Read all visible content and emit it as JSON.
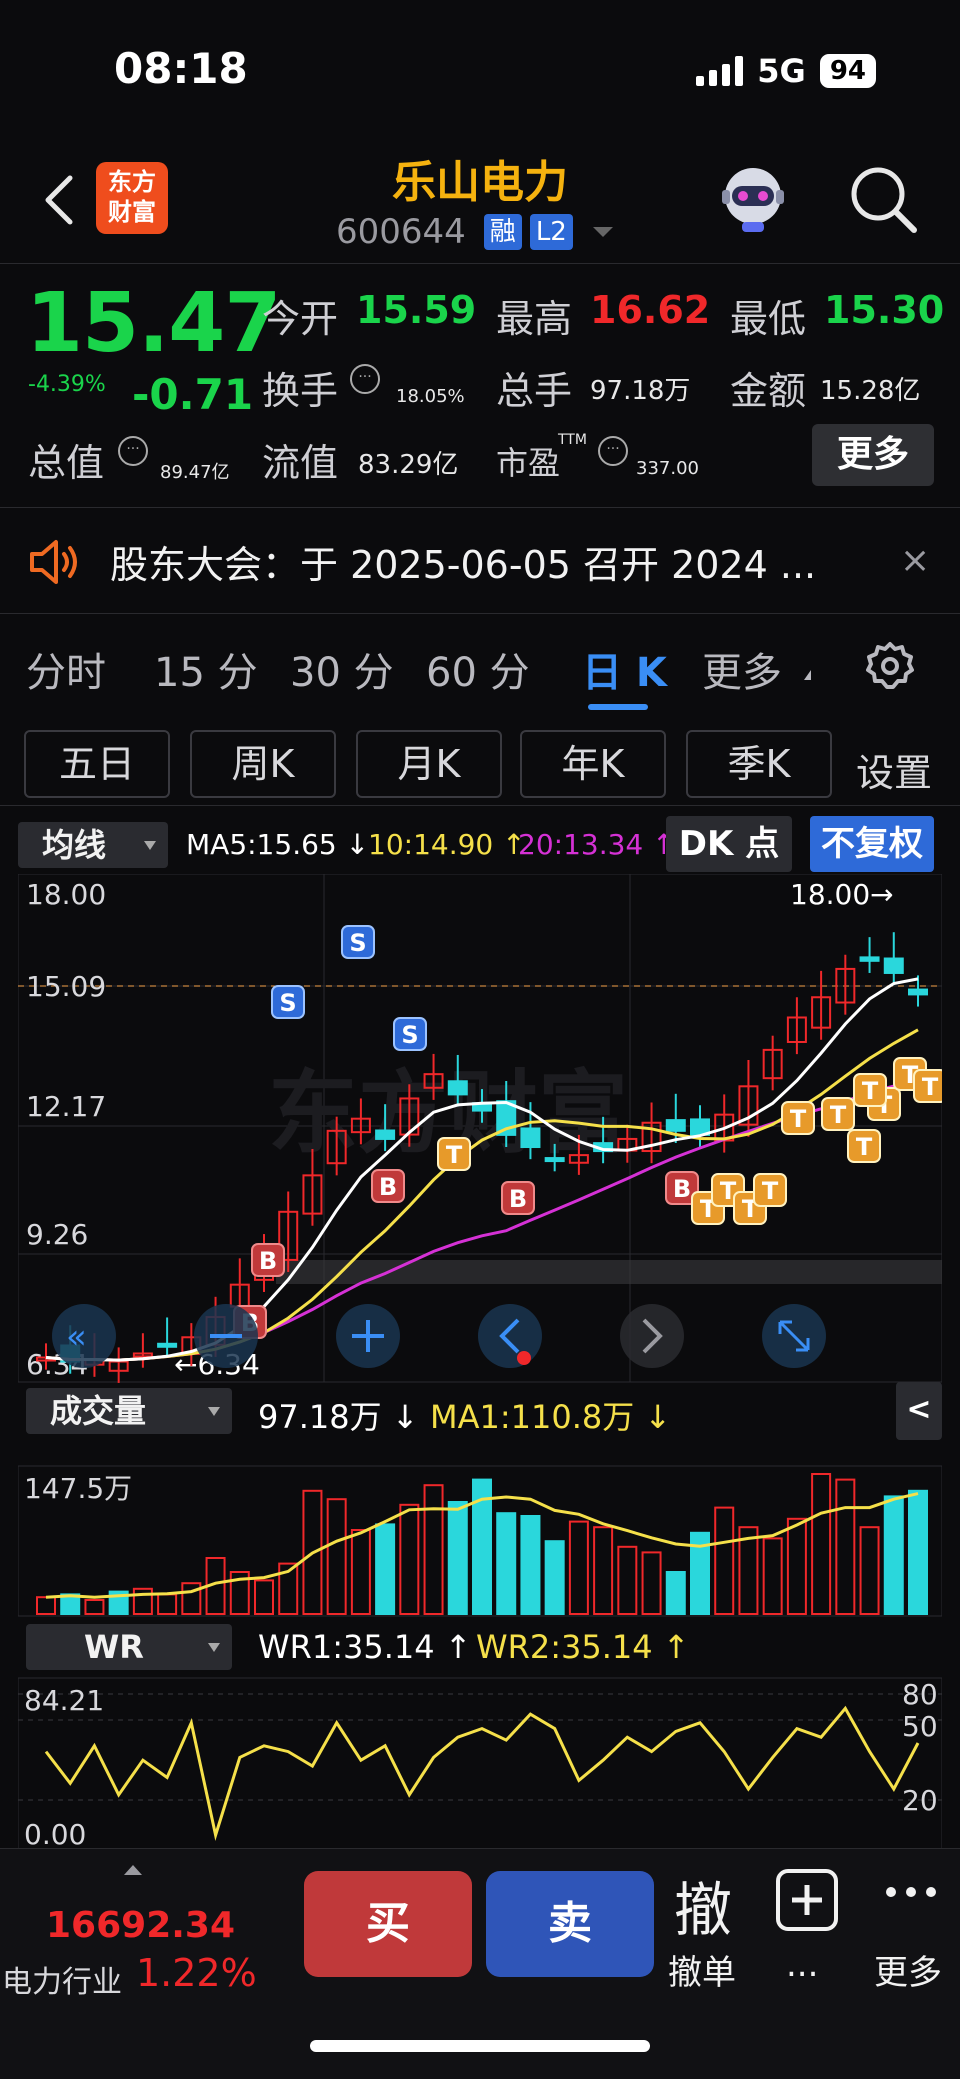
{
  "status_bar": {
    "time": "08:18",
    "network": "5G",
    "battery": "94"
  },
  "header": {
    "logo_line1": "东方",
    "logo_line2": "财富",
    "stock_name": "乐山电力",
    "stock_code": "600644",
    "tags": [
      "融",
      "L2"
    ]
  },
  "quote": {
    "price": "15.47",
    "change_pct": "-4.39%",
    "change": "-0.71",
    "open_label": "今开",
    "open": "15.59",
    "high_label": "最高",
    "high": "16.62",
    "low_label": "最低",
    "low": "15.30",
    "turnover_label": "换手",
    "turnover": "18.05%",
    "volume_label": "总手",
    "volume": "97.18万",
    "amount_label": "金额",
    "amount": "15.28亿",
    "mktcap_label": "总值",
    "mktcap": "89.47亿",
    "float_label": "流值",
    "float_cap": "83.29亿",
    "pe_label": "市盈",
    "pe_sup": "TTM",
    "pe": "337.00",
    "more": "更多",
    "colors": {
      "down": "#1ad44b",
      "up": "#f0282a"
    }
  },
  "notice": {
    "text": "股东大会：于 2025-06-05 召开 2024 ...",
    "close": "×"
  },
  "period_tabs": {
    "items": [
      "分时",
      "15 分",
      "30 分",
      "60 分",
      "日 K",
      "更多"
    ],
    "active": "日 K"
  },
  "sub_tabs": {
    "items": [
      "五日",
      "周K",
      "月K",
      "年K",
      "季K"
    ],
    "settings": "设置"
  },
  "ma_bar": {
    "selector": "均线",
    "ma5": "MA5:15.65 ↓",
    "ma10": "10:14.90 ↑",
    "ma20": "20:13.34 ↑",
    "dk": "DK 点",
    "adjust": "不复权",
    "colors": {
      "ma5": "#ffffff",
      "ma10": "#f5e04a",
      "ma20": "#d531d5"
    }
  },
  "price_chart": {
    "y_labels": [
      "18.00",
      "15.09",
      "12.17",
      "9.26",
      "6.34"
    ],
    "max_marker": "18.00→",
    "min_marker": "←6.34",
    "signal_labels": {
      "buy": "B",
      "sell": "S",
      "t": "T"
    }
  },
  "volume_bar": {
    "selector": "成交量",
    "vol": "97.18万 ↓",
    "ma1": "MA1:110.8万 ↓",
    "y_label": "147.5万",
    "collapse": "<"
  },
  "wr_bar": {
    "selector": "WR",
    "wr1": "WR1:35.14 ↑",
    "wr2": "WR2:35.14 ↑",
    "y_left_top": "84.21",
    "y_left_bottom": "0.00",
    "y_right": [
      "80",
      "50",
      "20"
    ]
  },
  "bottom_bar": {
    "index_value": "16692.34",
    "index_name": "电力行业",
    "index_pct": "1.22%",
    "buy": "买",
    "sell": "卖",
    "cancel_icon": "撤",
    "cancel": "撤单",
    "add": "...",
    "more": "更多"
  }
}
